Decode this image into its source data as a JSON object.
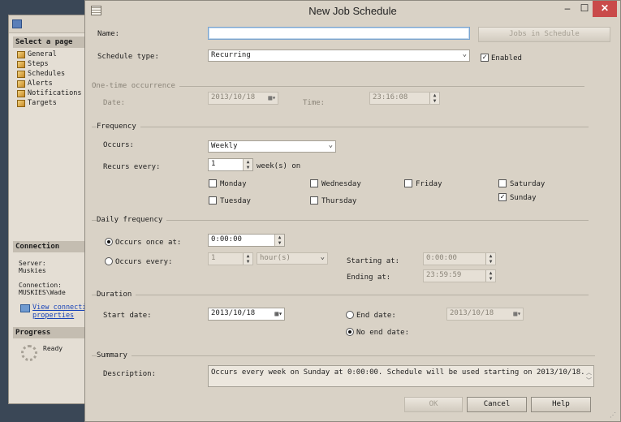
{
  "background_window": {
    "select_page_header": "Select a page",
    "pages": [
      "General",
      "Steps",
      "Schedules",
      "Alerts",
      "Notifications",
      "Targets"
    ],
    "connection_header": "Connection",
    "server_label": "Server:",
    "server_value": "Muskies",
    "connection_label": "Connection:",
    "connection_value": "MUSKIES\\Wade",
    "view_link_line1": "View connectic",
    "view_link_line2": "properties",
    "progress_header": "Progress",
    "progress_status": "Ready"
  },
  "dialog": {
    "title": "New Job Schedule",
    "minimize": "–",
    "maximize": "☐",
    "close": "✕",
    "name_label": "Name:",
    "name_value": "",
    "jobs_in_schedule_button": "Jobs in Schedule",
    "schedule_type_label": "Schedule type:",
    "schedule_type_value": "Recurring",
    "enabled_label": "Enabled",
    "one_time": {
      "header": "One-time occurrence",
      "date_label": "Date:",
      "date_value": "2013/10/18",
      "time_label": "Time:",
      "time_value": "23:16:08"
    },
    "frequency": {
      "header": "Frequency",
      "occurs_label": "Occurs:",
      "occurs_value": "Weekly",
      "recurs_label": "Recurs every:",
      "recurs_value": "1",
      "recurs_suffix": "week(s) on",
      "days": {
        "monday": "Monday",
        "tuesday": "Tuesday",
        "wednesday": "Wednesday",
        "thursday": "Thursday",
        "friday": "Friday",
        "saturday": "Saturday",
        "sunday": "Sunday"
      }
    },
    "daily": {
      "header": "Daily frequency",
      "once_label": "Occurs once at:",
      "once_value": "0:00:00",
      "every_label": "Occurs every:",
      "every_value": "1",
      "every_unit": "hour(s)",
      "starting_label": "Starting at:",
      "starting_value": "0:00:00",
      "ending_label": "Ending at:",
      "ending_value": "23:59:59"
    },
    "duration": {
      "header": "Duration",
      "start_label": "Start date:",
      "start_value": "2013/10/18",
      "end_label": "End date:",
      "end_value": "2013/10/18",
      "no_end_label": "No end date:"
    },
    "summary": {
      "header": "Summary",
      "description_label": "Description:",
      "description_value": "Occurs every week on Sunday at 0:00:00. Schedule will be used starting on 2013/10/18."
    },
    "buttons": {
      "ok": "OK",
      "cancel": "Cancel",
      "help": "Help"
    }
  }
}
